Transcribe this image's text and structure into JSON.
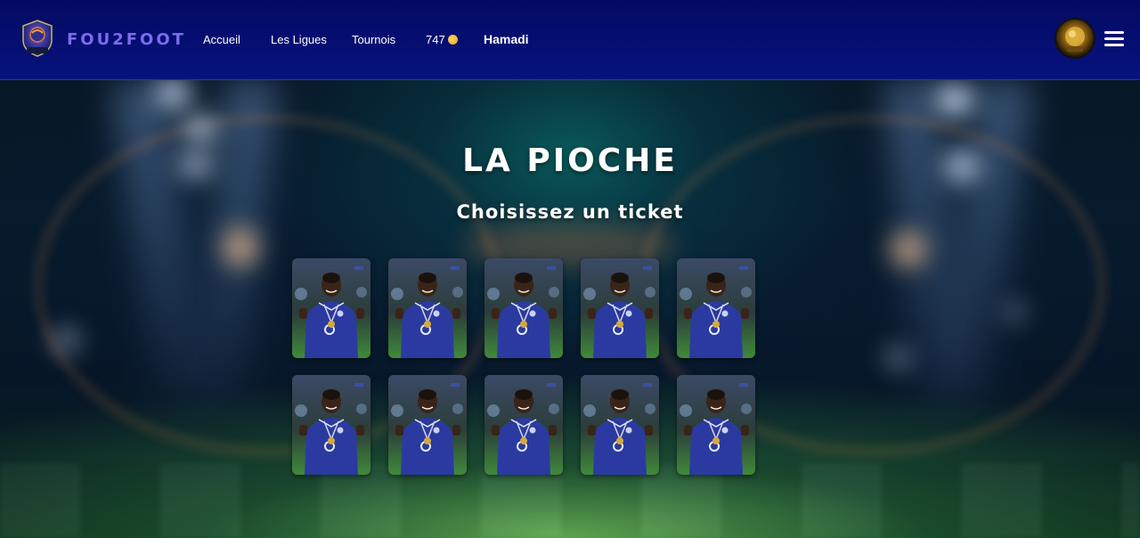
{
  "header": {
    "brand": "FOU2FOOT",
    "nav": [
      {
        "label": "Accueil"
      },
      {
        "label": "Les Ligues"
      },
      {
        "label": "Tournois"
      }
    ],
    "coins": "747",
    "username": "Hamadi"
  },
  "main": {
    "title": "LA PIOCHE",
    "subtitle": "Choisissez un ticket",
    "tickets_count": 10
  },
  "colors": {
    "navbar": "#030a62",
    "brand": "#7c6cf0",
    "coin": "#f0b030",
    "jersey": "#2b3aa0",
    "pitch": "#3f8a3a"
  },
  "icons": {
    "menu": "hamburger-menu-icon",
    "coin": "coin-icon"
  }
}
